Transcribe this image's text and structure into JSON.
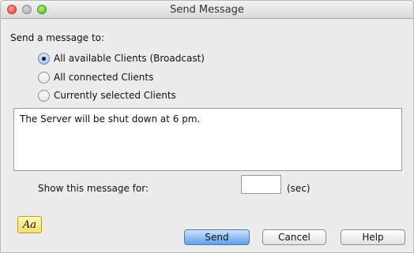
{
  "window": {
    "title": "Send Message"
  },
  "form": {
    "prompt": "Send a message to:",
    "options": [
      {
        "label": "All available Clients (Broadcast)",
        "selected": true
      },
      {
        "label": "All connected Clients",
        "selected": false
      },
      {
        "label": "Currently selected Clients",
        "selected": false
      }
    ],
    "message": "The Server will be shut down at 6 pm.",
    "duration_label": "Show this message for:",
    "duration_value": "",
    "duration_unit": "(sec)"
  },
  "buttons": {
    "font": "Aa",
    "send": "Send",
    "cancel": "Cancel",
    "help": "Help"
  }
}
